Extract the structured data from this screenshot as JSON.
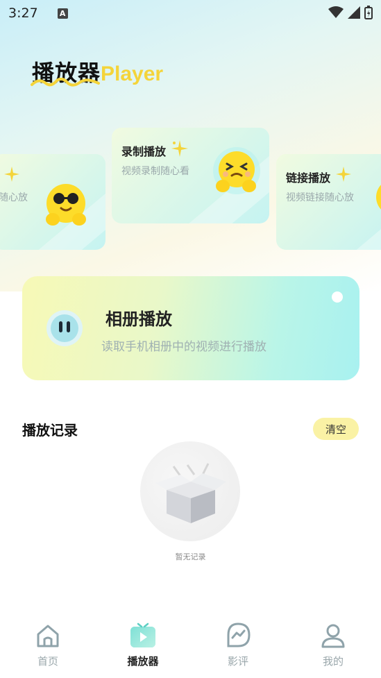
{
  "status_bar": {
    "time": "3:27",
    "notification_glyph": "A"
  },
  "header": {
    "title_cn": "播放器",
    "title_en": "Player"
  },
  "cards": [
    {
      "title": "录制播放",
      "subtitle": "视频录制随心看",
      "emoji": "squinting-face-icon"
    },
    {
      "title": "链接播放",
      "subtitle": "视频链接随心放",
      "emoji": "smiling-face-icon"
    },
    {
      "title": "",
      "subtitle": "随心放",
      "emoji": "sunglasses-face-icon"
    }
  ],
  "album": {
    "title": "相册播放",
    "subtitle": "读取手机相册中的视频进行播放"
  },
  "history": {
    "title": "播放记录",
    "clear_label": "清空",
    "empty_text": "暂无记录"
  },
  "tabbar": {
    "items": [
      {
        "label": "首页",
        "icon": "home-icon"
      },
      {
        "label": "播放器",
        "icon": "player-icon",
        "active": true
      },
      {
        "label": "影评",
        "icon": "review-icon"
      },
      {
        "label": "我的",
        "icon": "profile-icon"
      }
    ]
  },
  "colors": {
    "accent_yellow": "#f4d43a",
    "clear_bg": "#faf2a5",
    "tab_inactive": "#9aa7ab"
  }
}
